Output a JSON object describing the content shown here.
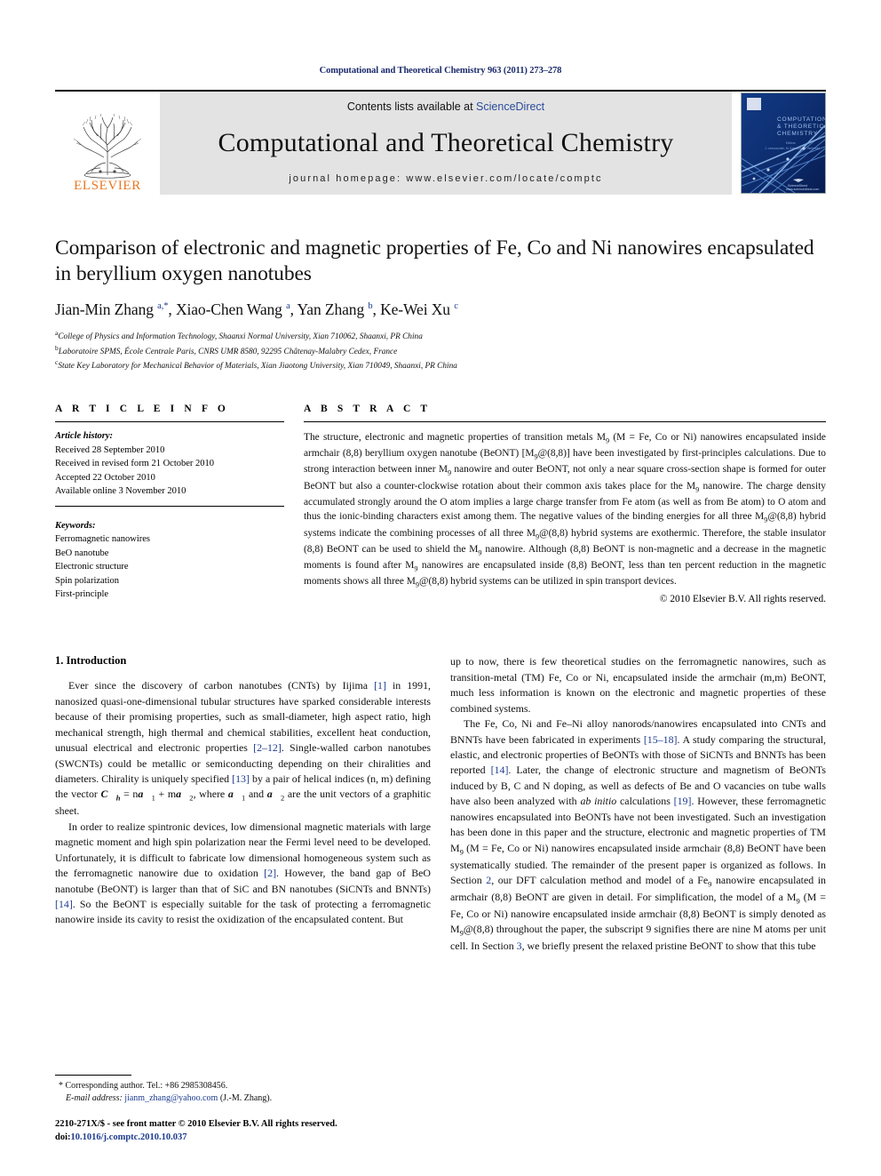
{
  "running_head": "Computational and Theoretical Chemistry 963 (2011) 273–278",
  "masthead": {
    "contents_prefix": "Contents lists available at ",
    "sciencedirect": "ScienceDirect",
    "journal_name": "Computational and Theoretical Chemistry",
    "homepage": "journal homepage: www.elsevier.com/locate/comptc",
    "publisher_logo_text": "ELSEVIER",
    "cover_title_lines": [
      "COMPUTATIONAL",
      "& THEORETICAL",
      "CHEMISTRY"
    ],
    "cover_editor_line": "Editors",
    "cover_publisher": "ScienceDirect",
    "colors": {
      "link": "#2a4b9b",
      "elsevier_orange": "#E87722",
      "masthead_bg": "#e3e3e3",
      "cover_blue": "#0b2d6b"
    }
  },
  "title": "Comparison of electronic and magnetic properties of Fe, Co and Ni nanowires encapsulated in beryllium oxygen nanotubes",
  "authors_html": "Jian-Min Zhang <sup>a,*</sup>, Xiao-Chen Wang <sup>a</sup>, Yan Zhang <sup>b</sup>, Ke-Wei Xu <sup>c</sup>",
  "affiliations": [
    {
      "marker": "a",
      "text": "College of Physics and Information Technology, Shaanxi Normal University, Xian 710062, Shaanxi, PR China"
    },
    {
      "marker": "b",
      "text": "Laboratoire SPMS, École Centrale Paris, CNRS UMR 8580, 92295 Châtenay-Malabry Cedex, France"
    },
    {
      "marker": "c",
      "text": "State Key Laboratory for Mechanical Behavior of Materials, Xian Jiaotong University, Xian 710049, Shaanxi, PR China"
    }
  ],
  "article_info": {
    "heading": "A R T I C L E    I N F O",
    "history_title": "Article history:",
    "history": [
      "Received 28 September 2010",
      "Received in revised form 21 October 2010",
      "Accepted 22 October 2010",
      "Available online 3 November 2010"
    ],
    "keywords_title": "Keywords:",
    "keywords": [
      "Ferromagnetic nanowires",
      "BeO nanotube",
      "Electronic structure",
      "Spin polarization",
      "First-principle"
    ]
  },
  "abstract": {
    "heading": "A B S T R A C T",
    "text_html": "The structure, electronic and magnetic properties of transition metals M<sub>9</sub> (M = Fe, Co or Ni) nanowires encapsulated inside armchair (8,8) beryllium oxygen nanotube (BeONT) [M<sub>9</sub>@(8,8)] have been investigated by first-principles calculations. Due to strong interaction between inner M<sub>9</sub> nanowire and outer BeONT, not only a near square cross-section shape is formed for outer BeONT but also a counter-clockwise rotation about their common axis takes place for the M<sub>9</sub> nanowire. The charge density accumulated strongly around the O atom implies a large charge transfer from Fe atom (as well as from Be atom) to O atom and thus the ionic-binding characters exist among them. The negative values of the binding energies for all three M<sub>9</sub>@(8,8) hybrid systems indicate the combining processes of all three M<sub>9</sub>@(8,8) hybrid systems are exothermic. Therefore, the stable insulator (8,8) BeONT can be used to shield the M<sub>9</sub> nanowire. Although (8,8) BeONT is non-magnetic and a decrease in the magnetic moments is found after M<sub>9</sub> nanowires are encapsulated inside (8,8) BeONT, less than ten percent reduction in the magnetic moments shows all three M<sub>9</sub>@(8,8) hybrid systems can be utilized in spin transport devices.",
    "copyright": "© 2010 Elsevier B.V. All rights reserved."
  },
  "body": {
    "section_heading": "1. Introduction",
    "left_paragraphs_html": [
      "Ever since the discovery of carbon nanotubes (CNTs) by Iijima <span class=\"ref\">[1]</span> in 1991, nanosized quasi-one-dimensional tubular structures have sparked considerable interests because of their promising properties, such as small-diameter, high aspect ratio, high mechanical strength, high thermal and chemical stabilities, excellent heat conduction, unusual electrical and electronic properties <span class=\"ref\">[2–12]</span>. Single-walled carbon nanotubes (SWCNTs) could be metallic or semiconducting depending on their chiralities and diameters. Chirality is uniquely specified <span class=\"ref\">[13]</span> by a pair of helical indices (n, m) defining the vector <span class=\"vecC\">C&#8407;<sub>h</sub></span> = n<span class=\"vecC\">a&#8407;</span><sub>1</sub> + m<span class=\"vecC\">a&#8407;</span><sub>2</sub>, where <span class=\"vecC\">a&#8407;</span><sub>1</sub> and <span class=\"vecC\">a&#8407;</span><sub>2</sub> are the unit vectors of a graphitic sheet.",
      "In order to realize spintronic devices, low dimensional magnetic materials with large magnetic moment and high spin polarization near the Fermi level need to be developed. Unfortunately, it is difficult to fabricate low dimensional homogeneous system such as the ferromagnetic nanowire due to oxidation <span class=\"ref\">[2]</span>. However, the band gap of BeO nanotube (BeONT) is larger than that of SiC and BN nanotubes (SiCNTs and BNNTs) <span class=\"ref\">[14]</span>. So the BeONT is especially suitable for the task of protecting a ferromagnetic nanowire inside its cavity to resist the oxidization of the encapsulated content. But"
    ],
    "right_paragraphs_html": [
      "up to now, there is few theoretical studies on the ferromagnetic nanowires, such as transition-metal (TM) Fe, Co or Ni, encapsulated inside the armchair (m,m) BeONT, much less information is known on the electronic and magnetic properties of these combined systems.",
      "The Fe, Co, Ni and Fe–Ni alloy nanorods/nanowires encapsulated into CNTs and BNNTs have been fabricated in experiments <span class=\"ref\">[15–18]</span>. A study comparing the structural, elastic, and electronic properties of BeONTs with those of SiCNTs and BNNTs has been reported <span class=\"ref\">[14]</span>. Later, the change of electronic structure and magnetism of BeONTs induced by B, C and N doping, as well as defects of Be and O vacancies on tube walls have also been analyzed with <i>ab initio</i> calculations <span class=\"ref\">[19]</span>. However, these ferromagnetic nanowires encapsulated into BeONTs have not been investigated. Such an investigation has been done in this paper and the structure, electronic and magnetic properties of TM M<sub>9</sub> (M = Fe, Co or Ni) nanowires encapsulated inside armchair (8,8) BeONT have been systematically studied. The remainder of the present paper is organized as follows. In Section <span class=\"ref\">2</span>, our DFT calculation method and model of a Fe<sub>9</sub> nanowire encapsulated in armchair (8,8) BeONT are given in detail. For simplification, the model of a M<sub>9</sub> (M = Fe, Co or Ni) nanowire encapsulated inside armchair (8,8) BeONT is simply denoted as M<sub>9</sub>@(8,8) throughout the paper, the subscript 9 signifies there are nine M atoms per unit cell. In Section <span class=\"ref\">3</span>, we briefly present the relaxed pristine BeONT to show that this tube"
    ]
  },
  "footnotes": {
    "corresponding_html": "* Corresponding author. Tel.: +86 2985308456.",
    "email_label": "E-mail address:",
    "email": "jianm_zhang@yahoo.com",
    "email_suffix": "(J.-M. Zhang).",
    "imprint_line1": "2210-271X/$ - see front matter © 2010 Elsevier B.V. All rights reserved.",
    "doi_prefix": "doi:",
    "doi": "10.1016/j.comptc.2010.10.037"
  }
}
